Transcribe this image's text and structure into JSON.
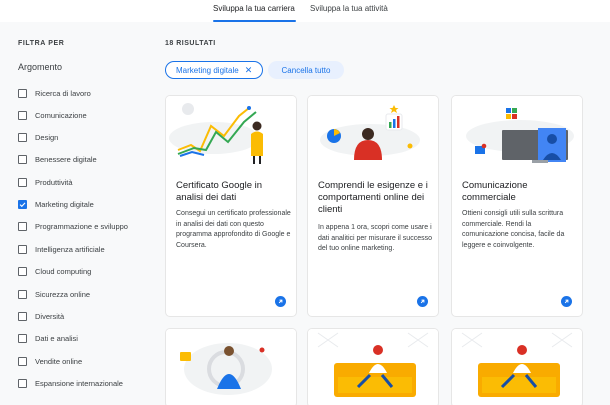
{
  "tabs": [
    {
      "label": "Sviluppa la tua carriera",
      "active": true
    },
    {
      "label": "Sviluppa la tua attività",
      "active": false
    }
  ],
  "sidebar": {
    "filter_title": "FILTRA PER",
    "argument_title": "Argomento",
    "items": [
      {
        "label": "Ricerca di lavoro",
        "checked": false
      },
      {
        "label": "Comunicazione",
        "checked": false
      },
      {
        "label": "Design",
        "checked": false
      },
      {
        "label": "Benessere digitale",
        "checked": false
      },
      {
        "label": "Produttività",
        "checked": false
      },
      {
        "label": "Marketing digitale",
        "checked": true
      },
      {
        "label": "Programmazione e sviluppo",
        "checked": false
      },
      {
        "label": "Intelligenza artificiale",
        "checked": false
      },
      {
        "label": "Cloud computing",
        "checked": false
      },
      {
        "label": "Sicurezza online",
        "checked": false
      },
      {
        "label": "Diversità",
        "checked": false
      },
      {
        "label": "Dati e analisi",
        "checked": false
      },
      {
        "label": "Vendite online",
        "checked": false
      },
      {
        "label": "Espansione internazionale",
        "checked": false
      }
    ]
  },
  "results": {
    "count_label": "18 RISULTATI",
    "active_filter": "Marketing digitale",
    "remove_symbol": "✕",
    "clear_all": "Cancella tutto"
  },
  "cards": [
    {
      "title": "Certificato Google in analisi dei dati",
      "description": "Consegui un certificato professionale in analisi dei dati con questo programma approfondito di Google e Coursera."
    },
    {
      "title": "Comprendi le esigenze e i comportamenti online dei clienti",
      "description": "In appena 1 ora, scopri come usare i dati analitici per misurare il successo del tuo online marketing."
    },
    {
      "title": "Comunicazione commerciale",
      "description": "Ottieni consigli utili sulla scrittura commerciale. Rendi la comunicazione concisa, facile da leggere e coinvolgente."
    }
  ],
  "colors": {
    "accent": "#1a73e8",
    "chip_bg": "#e8f0fe",
    "page_bg": "#f8f9fa"
  }
}
